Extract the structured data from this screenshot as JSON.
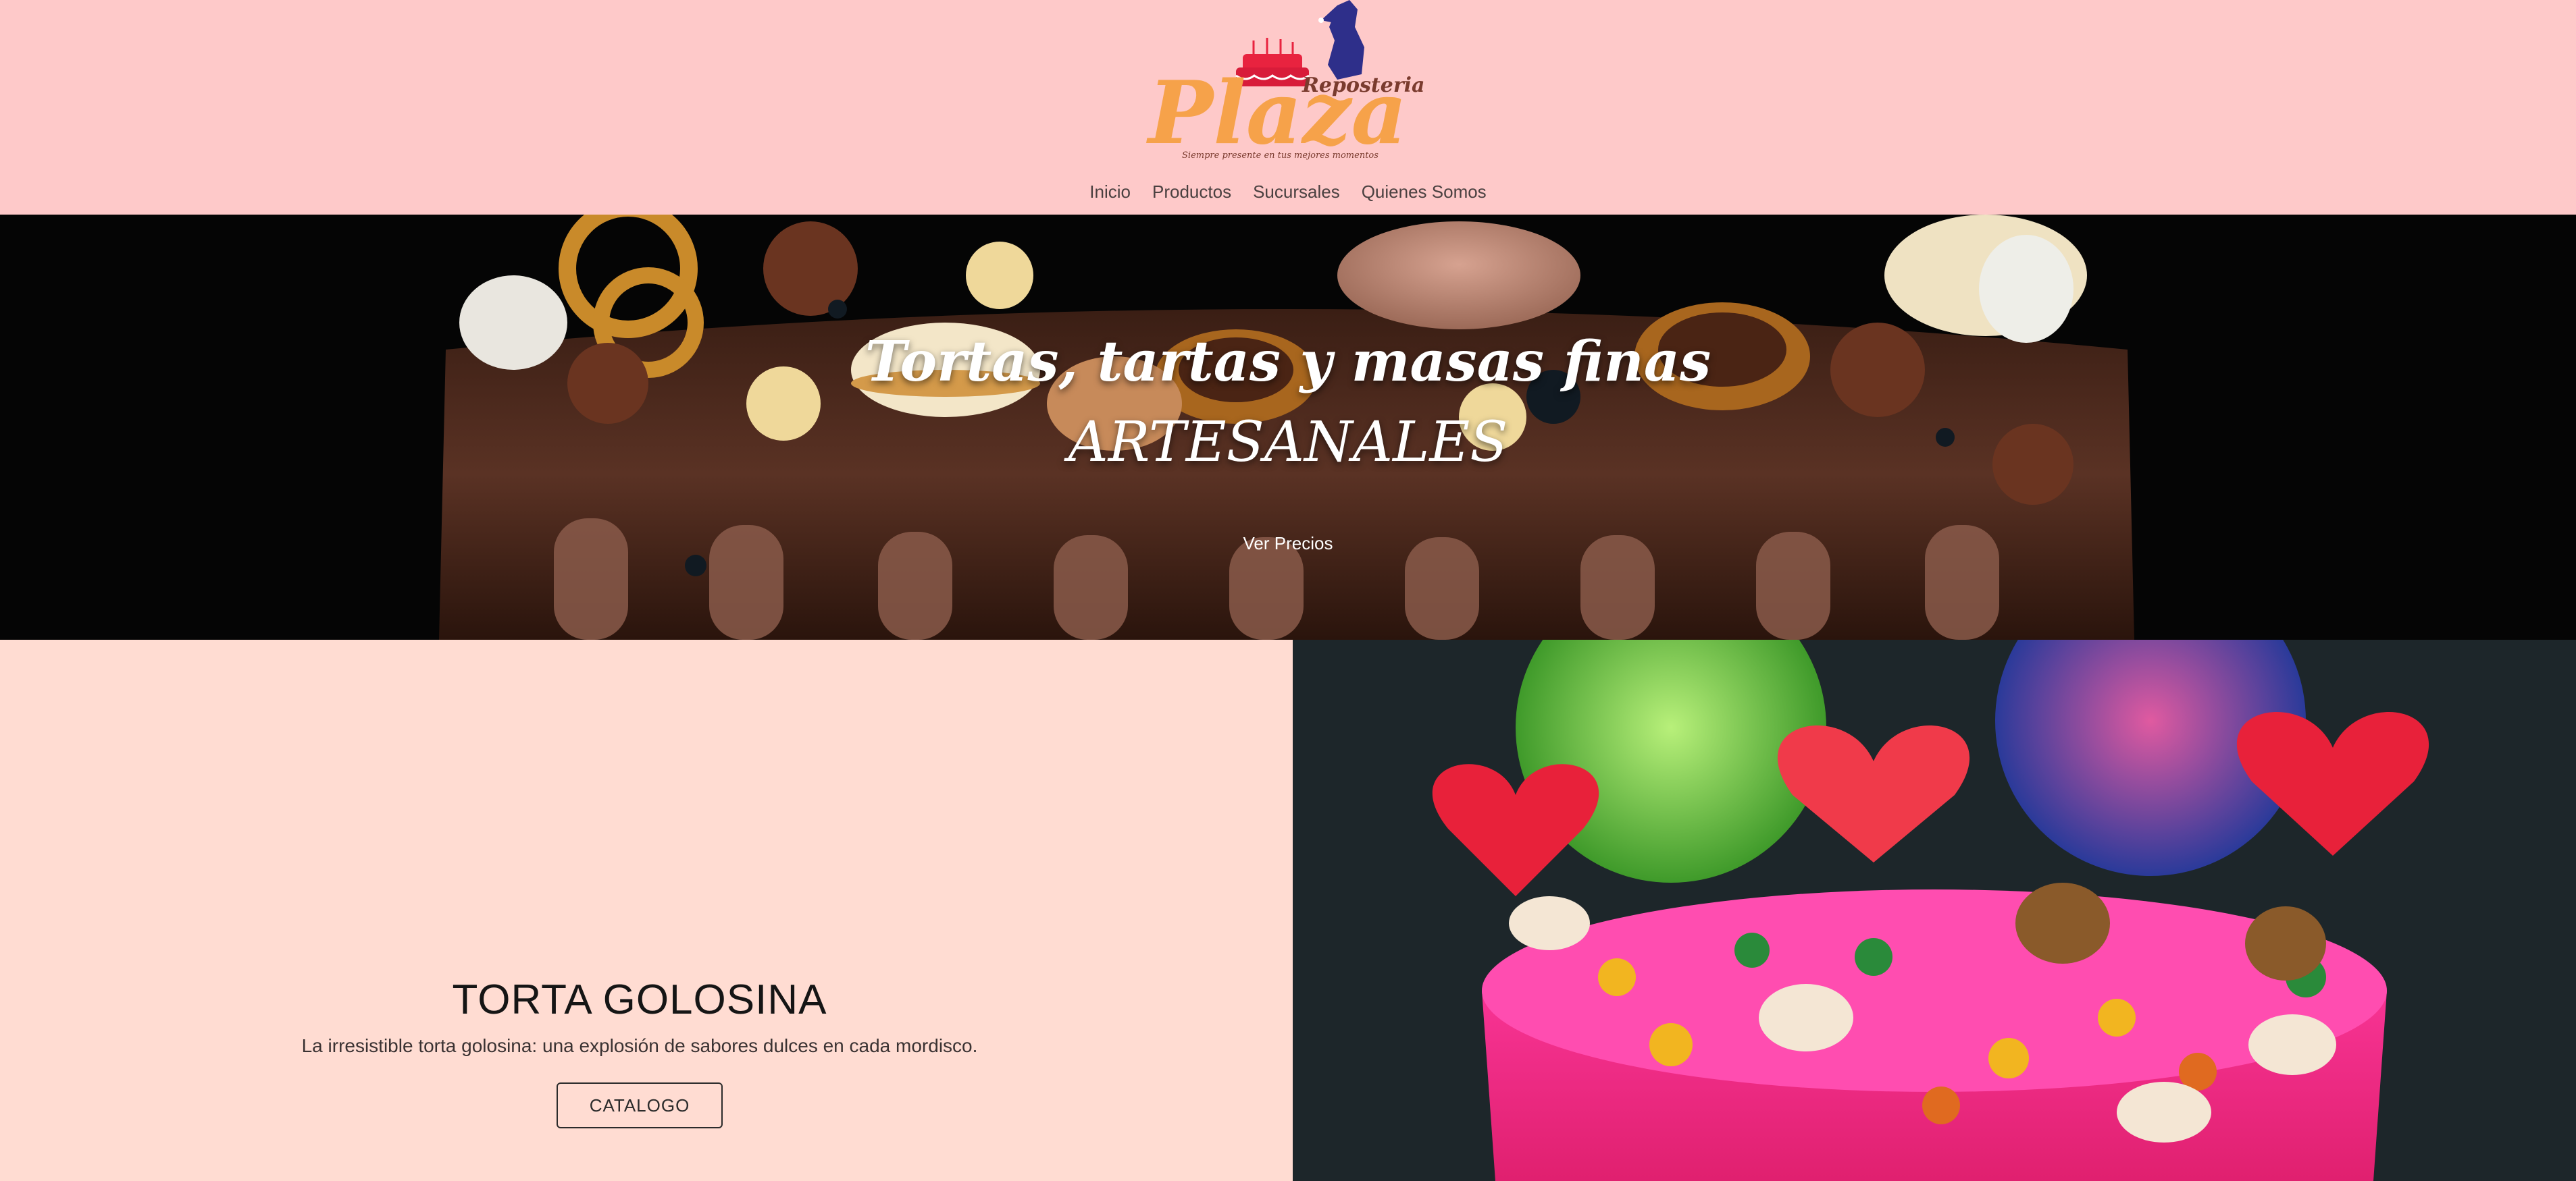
{
  "logo": {
    "brand": "Plaza",
    "subtitle": "Reposteria",
    "tagline": "Siempre presente en tus mejores momentos"
  },
  "nav": {
    "items": [
      {
        "label": "Inicio"
      },
      {
        "label": "Productos"
      },
      {
        "label": "Sucursales"
      },
      {
        "label": "Quienes Somos"
      }
    ]
  },
  "hero": {
    "title_line1": "Tortas, tartas y masas finas",
    "title_line2": "ARTESANALES",
    "button_label": "Ver Precios"
  },
  "feature": {
    "title": "TORTA GOLOSINA",
    "description": "La irresistible torta golosina: una explosión de sabores dulces en cada mordisco.",
    "button_label": "CATALOGO"
  },
  "colors": {
    "header_bg": "#fec9c9",
    "feature_bg": "#ffdcd2",
    "logo_orange": "#f6a24a",
    "logo_brown": "#7a3b2e",
    "logo_navy": "#2e2f8a"
  }
}
